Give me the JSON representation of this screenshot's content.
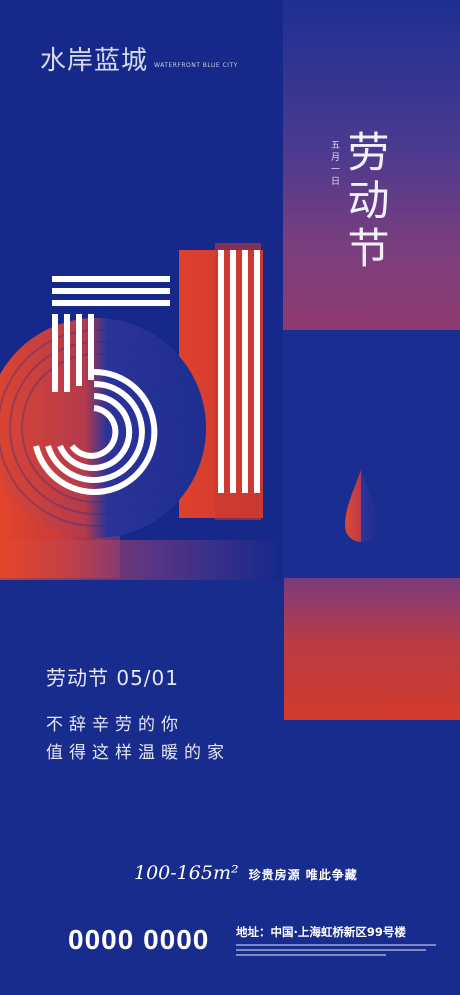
{
  "logo": {
    "name": "水岸蓝城",
    "sub": "WATERFRONT BLUE CITY"
  },
  "title": {
    "main": "劳动节",
    "date": "五月一日"
  },
  "festival_line": "劳动节 05/01",
  "slogan": [
    "不辞辛劳的你",
    "值得这样温暖的家"
  ],
  "area": "100-165m²",
  "tagline": "珍贵房源  唯此争藏",
  "phone": "0000 0000",
  "address": "地址：中国·上海虹桥新区99号楼",
  "colors": {
    "blue": "#16298a",
    "red": "#e2452c",
    "white": "#ffffff"
  }
}
